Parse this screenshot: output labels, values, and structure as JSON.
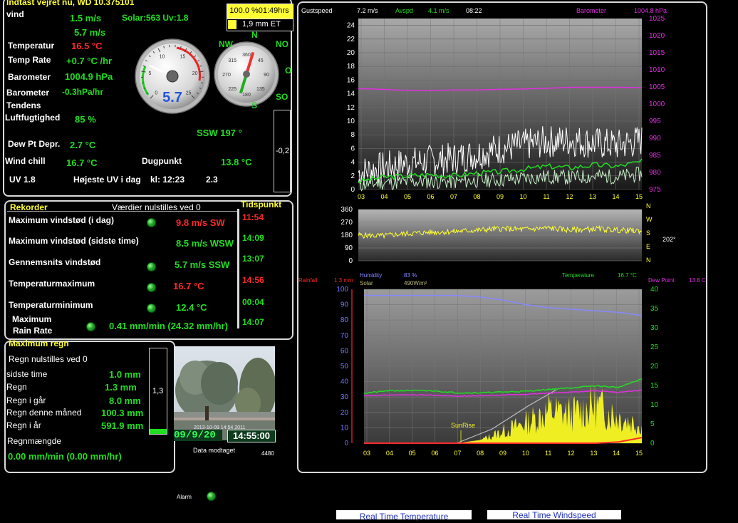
{
  "header": {
    "title": "Indtast vejret nu, WD 10.375101"
  },
  "badge": {
    "time": "100.0 %01:49hrs",
    "et": "1,9 mm ET"
  },
  "current": {
    "vind_label": "vind",
    "wind_speed": "1.5 m/s",
    "solar_uv": "Solar:563 Uv:1.8",
    "wind_avg": "5.7 m/s",
    "temp_label": "Temperatur",
    "temp_value": "16.5 °C",
    "rate_label": "Temp Rate",
    "rate_value": "+0.7 °C /hr",
    "baro_label": "Barometer",
    "baro_value": "1004.9 hPa",
    "trend_label1": "Barometer",
    "trend_label2": "Tendens",
    "trend_value": "-0.3hPa/hr",
    "hum_label": "Luftfugtighed",
    "hum_value": "85 %",
    "dir_value": "SSW  197 °",
    "dew_dep_label": "Dew Pt Depr.",
    "dew_dep_value": "2.7 °C",
    "chill_label": "Wind chill",
    "chill_value": "16.7 °C",
    "dugpunkt_label": "Dugpunkt",
    "dugpunkt_value": "13.8 °C",
    "uv_label": "UV  1.8",
    "uv_max_label": "Højeste UV i dag",
    "uv_max_time": "kl: 12:23",
    "uv_max_value": "2.3",
    "baro_bar_value": "-0,2",
    "compass": {
      "N": "N",
      "NW": "NW",
      "NO": "NO",
      "O": "O",
      "SO": "SO",
      "S": "S"
    }
  },
  "gauges": {
    "speed": {
      "value_text": "5.7",
      "ticks": [
        "0",
        "5",
        "10",
        "15",
        "20",
        "25"
      ],
      "fraction": 0.26
    },
    "direction": {
      "ticks": [
        "360",
        "45",
        "90",
        "135",
        "180",
        "225",
        "270",
        "315"
      ],
      "degrees": 197
    }
  },
  "records": {
    "title": "Rekorder",
    "note": "Værdier nulstilles ved 0",
    "time_title": "Tidspunkt",
    "rows": [
      {
        "label": "Maximum vindstød (i dag)",
        "value": "9.8 m/s  SW",
        "time": "11:54",
        "color": "#ff2a2a",
        "time_color": "#ff2a2a"
      },
      {
        "label": "Maximum vindstød (sidste time)",
        "value": "8.5 m/s WSW",
        "time": "14:09",
        "color": "#22dd22",
        "time_color": "#22dd22"
      },
      {
        "label": "Gennemsnits vindstød",
        "value": "5.7 m/s SSW",
        "time": "13:07",
        "color": "#22dd22",
        "time_color": "#22dd22"
      },
      {
        "label": "Temperaturmaximum",
        "value": "16.7 °C",
        "time": "14:56",
        "color": "#ff2a2a",
        "time_color": "#ff2a2a"
      },
      {
        "label": "Temperaturminimum",
        "value": "12.4 °C",
        "time": "00:04",
        "color": "#22dd22",
        "time_color": "#22dd22"
      }
    ],
    "rain_rate_label1": "Maximum",
    "rain_rate_label2": "Rain Rate",
    "rain_rate_value": "0.41 mm/min (24.32 mm/hr)",
    "rain_rate_time": "14:07"
  },
  "rain": {
    "title": "Maximum regn",
    "note": "Regn nulstilles ved 0",
    "rows": [
      {
        "label": "sidste time",
        "value": "1.0 mm"
      },
      {
        "label": "Regn",
        "value": "1.3 mm"
      },
      {
        "label": "Regn i går",
        "value": "8.0 mm"
      },
      {
        "label": "Regn denne måned",
        "value": "100.3 mm"
      },
      {
        "label": "Regn i år",
        "value": "591.9 mm"
      }
    ],
    "amount_label": "Regnmængde",
    "rate_value": "0.00 mm/min (0.00 mm/hr)",
    "bar_value": "1,3",
    "bar_fraction": 0.06
  },
  "webcam": {
    "date": "09/9/20",
    "time": "14:55:00",
    "stamp": "2013-10-09 14:54 2011",
    "received_label": "Data modtaget",
    "count": "4480"
  },
  "alarm": {
    "label": "Alarm"
  },
  "buttons": {
    "temp": "Real Time Temperature",
    "wind": "Real Time Windspeed"
  },
  "chart_data": [
    {
      "type": "line",
      "title": "",
      "legend": [
        {
          "label": "Gustspeed",
          "value": "7.2 m/s",
          "color": "#ffffff"
        },
        {
          "label": "Avspd",
          "value": "4.1 m/s",
          "color": "#22dd22"
        },
        {
          "label": "08:22",
          "value": "",
          "color": "#ffffff"
        },
        {
          "label": "Barometer",
          "value": "1004.8 hPa",
          "color": "#e030e0"
        }
      ],
      "x": [
        "03",
        "04",
        "05",
        "06",
        "07",
        "08",
        "09",
        "10",
        "11",
        "12",
        "13",
        "14",
        "15"
      ],
      "yticks_left": [
        "24",
        "22",
        "20",
        "18",
        "16",
        "14",
        "12",
        "10",
        "8",
        "6",
        "4",
        "2",
        "0"
      ],
      "yticks_right": [
        "1025",
        "1020",
        "1015",
        "1010",
        "1005",
        "1000",
        "995",
        "990",
        "985",
        "980",
        "975"
      ],
      "ylim": [
        0,
        25
      ],
      "ylim_right": [
        975,
        1025
      ],
      "series": [
        {
          "name": "Gustspeed",
          "color": "#ffffff",
          "values": [
            2.5,
            3.2,
            3.8,
            4.2,
            4.5,
            5.2,
            6.0,
            6.5,
            7.0,
            7.2,
            6.8,
            6.5,
            7.2
          ]
        },
        {
          "name": "Avspd",
          "color": "#22dd22",
          "values": [
            1.2,
            1.8,
            2.0,
            2.2,
            2.0,
            2.4,
            2.6,
            3.0,
            3.4,
            3.2,
            3.6,
            3.4,
            4.1
          ]
        },
        {
          "name": "Barometer",
          "color": "#e030e0",
          "axis": "right",
          "values": [
            1004.5,
            1004.3,
            1004.0,
            1003.9,
            1004.1,
            1004.1,
            1004.3,
            1004.4,
            1004.6,
            1004.9,
            1004.9,
            1004.9,
            1004.8
          ]
        }
      ]
    },
    {
      "type": "line",
      "title": "",
      "x": [
        "03",
        "04",
        "05",
        "06",
        "07",
        "08",
        "09",
        "10",
        "11",
        "12",
        "13",
        "14",
        "15"
      ],
      "yticks_left": [
        "360",
        "270",
        "180",
        "90",
        "0"
      ],
      "labels_right": [
        "N",
        "W",
        "S",
        "E",
        "N"
      ],
      "current_value": "202°",
      "ylim": [
        0,
        360
      ],
      "series": [
        {
          "name": "Wind direction",
          "color": "#ffff33",
          "values": [
            180,
            175,
            190,
            200,
            205,
            215,
            225,
            220,
            230,
            215,
            225,
            215,
            210
          ]
        }
      ]
    },
    {
      "type": "area",
      "title": "",
      "legend": [
        {
          "label": "Rainfall",
          "value": "1.3 mm",
          "color": "#ff2a2a"
        },
        {
          "label": "Humidity",
          "value": "83 %",
          "color": "#8888ff"
        },
        {
          "label": "Solar",
          "value": "490W/m²",
          "color": "#dddd22"
        },
        {
          "label": "Temperature",
          "value": "16.7 °C",
          "color": "#22dd22"
        },
        {
          "label": "Dew Point",
          "value": "13.8 C",
          "color": "#e030e0"
        }
      ],
      "annotation": "SunRise",
      "x": [
        "03",
        "04",
        "05",
        "06",
        "07",
        "08",
        "09",
        "10",
        "11",
        "12",
        "13",
        "14",
        "15"
      ],
      "yticks_left": [
        "100",
        "90",
        "80",
        "70",
        "60",
        "50",
        "40",
        "30",
        "20",
        "10",
        "0"
      ],
      "yticks_right": [
        "40",
        "35",
        "30",
        "25",
        "20",
        "15",
        "10",
        "5",
        "0"
      ],
      "ylim": [
        0,
        100
      ],
      "ylim_right": [
        0,
        40
      ],
      "series": [
        {
          "name": "Humidity",
          "color": "#8888ff",
          "axis": "left",
          "values": [
            96,
            96,
            96,
            96,
            96,
            95,
            93,
            90,
            88,
            87,
            86,
            85,
            83
          ]
        },
        {
          "name": "Temperature",
          "color": "#22dd22",
          "axis": "right",
          "values": [
            13.0,
            13.6,
            13.7,
            13.6,
            13.1,
            13.1,
            13.3,
            13.5,
            14.0,
            14.4,
            14.9,
            14.5,
            16.7
          ]
        },
        {
          "name": "Dew Point",
          "color": "#e030e0",
          "axis": "right",
          "values": [
            12.3,
            12.5,
            12.6,
            12.5,
            12.2,
            12.3,
            12.5,
            12.7,
            13.0,
            13.3,
            13.6,
            13.2,
            13.8
          ]
        },
        {
          "name": "Rainfall",
          "color": "#ff2a2a",
          "axis": "right",
          "values": [
            0,
            0,
            0,
            0,
            0,
            0,
            0,
            0,
            0,
            0,
            0,
            0.3,
            1.3
          ]
        },
        {
          "name": "Solar",
          "color": "#eeee22",
          "axis": "left",
          "values": [
            0,
            0,
            0,
            0,
            0,
            2,
            8,
            14,
            22,
            20,
            26,
            18,
            12
          ]
        }
      ]
    }
  ]
}
